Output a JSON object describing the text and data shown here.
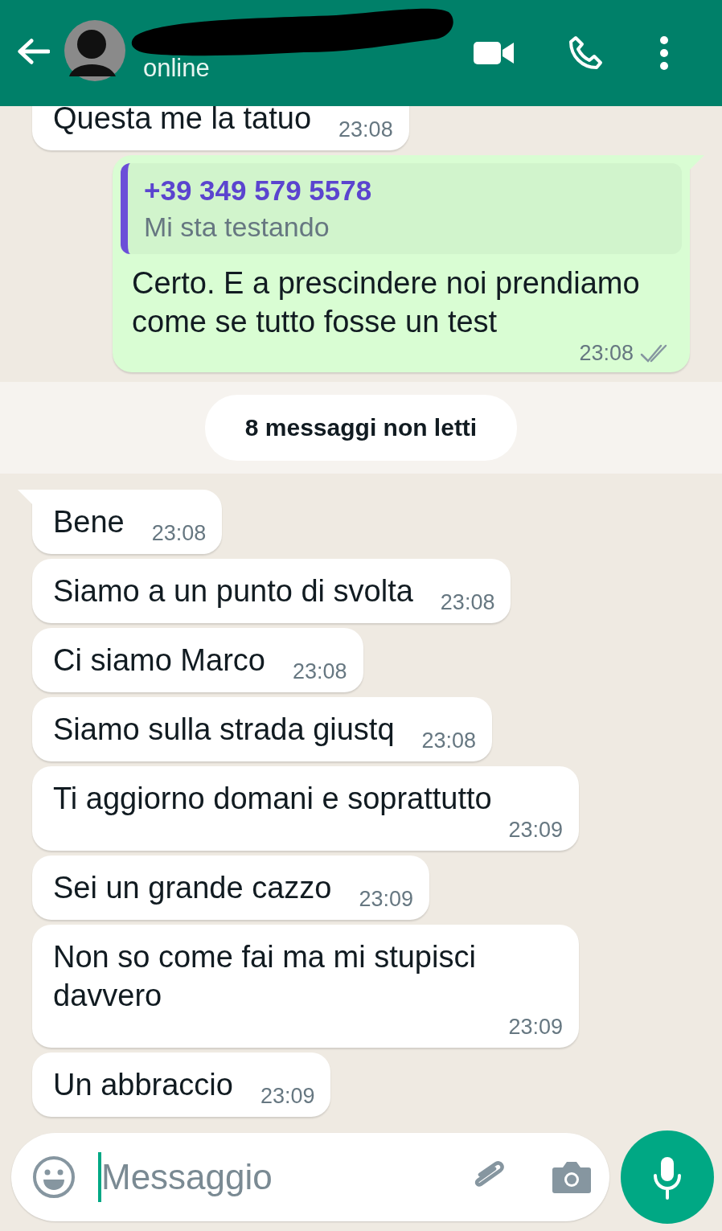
{
  "header": {
    "status": "online"
  },
  "messages": [
    {
      "kind": "incoming",
      "text": "Questa me la tatuo",
      "time": "23:08"
    },
    {
      "kind": "outgoing",
      "tail": true,
      "quote": {
        "author": "+39 349 579 5578",
        "text": "Mi sta testando"
      },
      "text": "Certo. E a prescindere noi prendiamo come se tutto fosse un test",
      "time": "23:08",
      "read": false
    },
    {
      "kind": "unread",
      "label": "8 messaggi non letti"
    },
    {
      "kind": "incoming",
      "tail": true,
      "text": "Bene",
      "time": "23:08"
    },
    {
      "kind": "incoming",
      "tail": false,
      "text": "Siamo a un punto di svolta",
      "time": "23:08"
    },
    {
      "kind": "incoming",
      "tail": false,
      "text": "Ci siamo Marco",
      "time": "23:08"
    },
    {
      "kind": "incoming",
      "tail": false,
      "text": "Siamo sulla strada giustq",
      "time": "23:08"
    },
    {
      "kind": "incoming",
      "tail": false,
      "text": "Ti aggiorno domani e soprattutto",
      "time": "23:09"
    },
    {
      "kind": "incoming",
      "tail": false,
      "text": "Sei un grande cazzo",
      "time": "23:09"
    },
    {
      "kind": "incoming",
      "tail": false,
      "text": "Non so come fai ma mi stupisci davvero",
      "time": "23:09"
    },
    {
      "kind": "incoming",
      "tail": false,
      "text": "Un abbraccio",
      "time": "23:09"
    }
  ],
  "composer": {
    "placeholder": "Messaggio"
  }
}
